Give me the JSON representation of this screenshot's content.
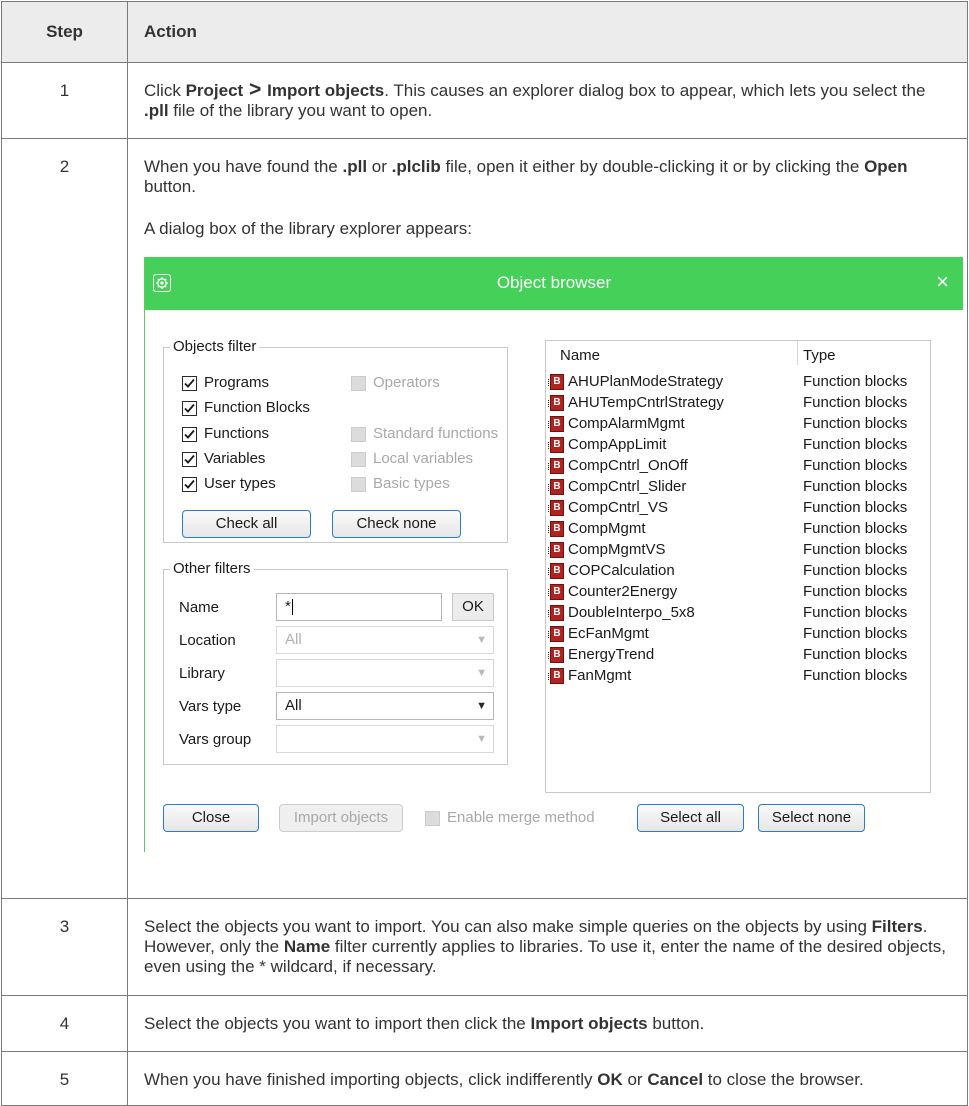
{
  "table": {
    "header": {
      "step": "Step",
      "action": "Action"
    },
    "rows": [
      {
        "num": "1",
        "parts": [
          "Click ",
          "Project",
          " > ",
          "Import objects",
          ". This causes an explorer dialog box to appear, which lets you select the ",
          ".pll",
          " file of the library you want to open."
        ]
      },
      {
        "num": "2",
        "parts": [
          "When you have found the ",
          ".pll",
          " or ",
          ".plclib",
          " file, open it either by double-clicking it or by clicking the ",
          "Open",
          " button."
        ],
        "after": "A dialog box of the library explorer appears:"
      },
      {
        "num": "3",
        "parts": [
          "Select the objects you want to import. You can also make simple queries on the objects by using ",
          "Filters",
          ". However, only the ",
          "Name",
          " filter currently applies to libraries. To use it, enter the name of the desired objects, even using the * wildcard, if necessary."
        ]
      },
      {
        "num": "4",
        "parts": [
          "Select the objects you want to import then click the ",
          "Import objects",
          " button."
        ]
      },
      {
        "num": "5",
        "parts": [
          "When you have finished importing objects, click indifferently ",
          "OK",
          " or ",
          "Cancel",
          " to close the browser."
        ]
      }
    ]
  },
  "dialog": {
    "title": "Object browser",
    "close_glyph": "×",
    "accent_color": "#44d059",
    "objects_filter": {
      "label": "Objects filter",
      "checkboxes": [
        {
          "label": "Programs",
          "checked": true,
          "enabled": true
        },
        {
          "label": "Operators",
          "checked": false,
          "enabled": false
        },
        {
          "label": "Function Blocks",
          "checked": true,
          "enabled": true
        },
        {
          "label": "Functions",
          "checked": true,
          "enabled": true
        },
        {
          "label": "Standard functions",
          "checked": false,
          "enabled": false
        },
        {
          "label": "Variables",
          "checked": true,
          "enabled": true
        },
        {
          "label": "Local variables",
          "checked": false,
          "enabled": false
        },
        {
          "label": "User types",
          "checked": true,
          "enabled": true
        },
        {
          "label": "Basic types",
          "checked": false,
          "enabled": false
        }
      ],
      "check_all": "Check all",
      "check_none": "Check none"
    },
    "other_filters": {
      "label": "Other filters",
      "name_label": "Name",
      "name_value": "*",
      "ok": "OK",
      "location_label": "Location",
      "location_value": "All",
      "library_label": "Library",
      "library_value": "",
      "vars_type_label": "Vars type",
      "vars_type_value": "All",
      "vars_group_label": "Vars group",
      "vars_group_value": ""
    },
    "list": {
      "col_name": "Name",
      "col_type": "Type",
      "icon_letter": "B",
      "rows": [
        {
          "name": "AHUPlanModeStrategy",
          "type": "Function blocks"
        },
        {
          "name": "AHUTempCntrlStrategy",
          "type": "Function blocks"
        },
        {
          "name": "CompAlarmMgmt",
          "type": "Function blocks"
        },
        {
          "name": "CompAppLimit",
          "type": "Function blocks"
        },
        {
          "name": "CompCntrl_OnOff",
          "type": "Function blocks"
        },
        {
          "name": "CompCntrl_Slider",
          "type": "Function blocks"
        },
        {
          "name": "CompCntrl_VS",
          "type": "Function blocks"
        },
        {
          "name": "CompMgmt",
          "type": "Function blocks"
        },
        {
          "name": "CompMgmtVS",
          "type": "Function blocks"
        },
        {
          "name": "COPCalculation",
          "type": "Function blocks"
        },
        {
          "name": "Counter2Energy",
          "type": "Function blocks"
        },
        {
          "name": "DoubleInterpo_5x8",
          "type": "Function blocks"
        },
        {
          "name": "EcFanMgmt",
          "type": "Function blocks"
        },
        {
          "name": "EnergyTrend",
          "type": "Function blocks"
        },
        {
          "name": "FanMgmt",
          "type": "Function blocks"
        }
      ]
    },
    "footer": {
      "close": "Close",
      "import_objects": "Import objects",
      "enable_merge": "Enable merge method",
      "select_all": "Select all",
      "select_none": "Select none"
    }
  }
}
